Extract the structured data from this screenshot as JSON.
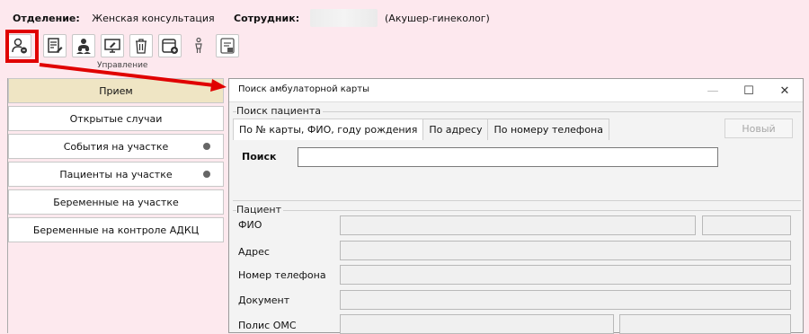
{
  "header": {
    "department_label": "Отделение:",
    "department_value": "Женская консультация",
    "employee_label": "Сотрудник:",
    "employee_role": "(Акушер-гинеколог)"
  },
  "toolbar": {
    "group_label": "Управление",
    "buttons": [
      "user-search",
      "document-edit",
      "users-group",
      "monitor-edit",
      "trash",
      "card-add",
      "person",
      "list-card"
    ]
  },
  "sidebar": {
    "items": [
      {
        "label": "Прием",
        "active": true,
        "dot": false
      },
      {
        "label": "Открытые случаи",
        "dot": false
      },
      {
        "label": "События на участке",
        "dot": true
      },
      {
        "label": "Пациенты на участке",
        "dot": true
      },
      {
        "label": "Беременные на участке",
        "dot": false
      },
      {
        "label": "Беременные на контроле АДКЦ",
        "dot": false
      }
    ]
  },
  "dialog": {
    "title": "Поиск амбулаторной карты",
    "minimize": "—",
    "maximize": "☐",
    "close": "✕",
    "patient_search_group": "Поиск пациента",
    "tabs": [
      "По № карты, ФИО, году рождения",
      "По адресу",
      "По номеру телефона"
    ],
    "new_button": "Новый",
    "search_label": "Поиск",
    "search_value": "",
    "patient_group": "Пациент",
    "fields": {
      "fio": "ФИО",
      "address": "Адрес",
      "phone": "Номер телефона",
      "document": "Документ",
      "oms": "Полис ОМС"
    }
  },
  "colors": {
    "highlight": "#e00000",
    "background": "#fde9ee",
    "active_item": "#efe5c4"
  }
}
